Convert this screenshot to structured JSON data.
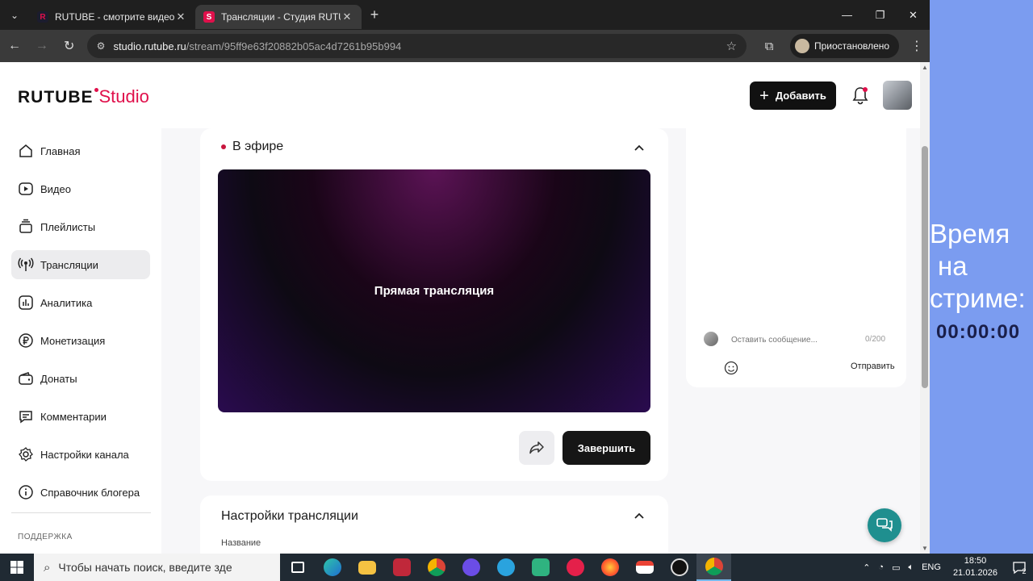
{
  "browser": {
    "tabs": [
      {
        "title": "RUTUBE - смотрите видео онл",
        "favicon": "R",
        "favicon_color": "#e0104b",
        "active": false
      },
      {
        "title": "Трансляции - Студия RUTUBE",
        "favicon": "S",
        "favicon_color": "#e0104b",
        "active": true
      }
    ],
    "url_host": "studio.rutube.ru",
    "url_path": "/stream/95ff9e63f20882b05ac4d7261b95b994",
    "profile_label": "Приостановлено"
  },
  "header": {
    "logo_main": "RUTUBE",
    "logo_sub": "Studio",
    "add_label": "Добавить"
  },
  "sidebar": {
    "items": [
      {
        "label": "Главная",
        "icon": "home-icon",
        "active": false
      },
      {
        "label": "Видео",
        "icon": "video-icon",
        "active": false
      },
      {
        "label": "Плейлисты",
        "icon": "playlist-icon",
        "active": false
      },
      {
        "label": "Трансляции",
        "icon": "broadcast-icon",
        "active": true
      },
      {
        "label": "Аналитика",
        "icon": "analytics-icon",
        "active": false
      },
      {
        "label": "Монетизация",
        "icon": "ruble-icon",
        "active": false
      },
      {
        "label": "Донаты",
        "icon": "wallet-icon",
        "active": false
      },
      {
        "label": "Комментарии",
        "icon": "comment-icon",
        "active": false
      },
      {
        "label": "Настройки канала",
        "icon": "gear-icon",
        "active": false
      },
      {
        "label": "Справочник блогера",
        "icon": "info-icon",
        "active": false
      }
    ],
    "support_label": "ПОДДЕРЖКА"
  },
  "live": {
    "title": "В эфире",
    "player_label": "Прямая трансляция",
    "finish_label": "Завершить"
  },
  "settings": {
    "title": "Настройки трансляции",
    "field_label": "Название"
  },
  "chat": {
    "placeholder": "Оставить сообщение...",
    "counter": "0/200",
    "send_label": "Отправить"
  },
  "overlay": {
    "line1": "Время",
    "line2": "на",
    "line3": "стриме:",
    "timer": "00:00:00"
  },
  "taskbar": {
    "search_placeholder": "Чтобы начать поиск, введите зде",
    "lang": "ENG",
    "time": "18:50",
    "date": "21.01.2026",
    "notif_count": "2"
  },
  "colors": {
    "accent": "#e0104b",
    "overlay_bg": "#7b9cf0",
    "help_fab": "#1f8f8f"
  }
}
